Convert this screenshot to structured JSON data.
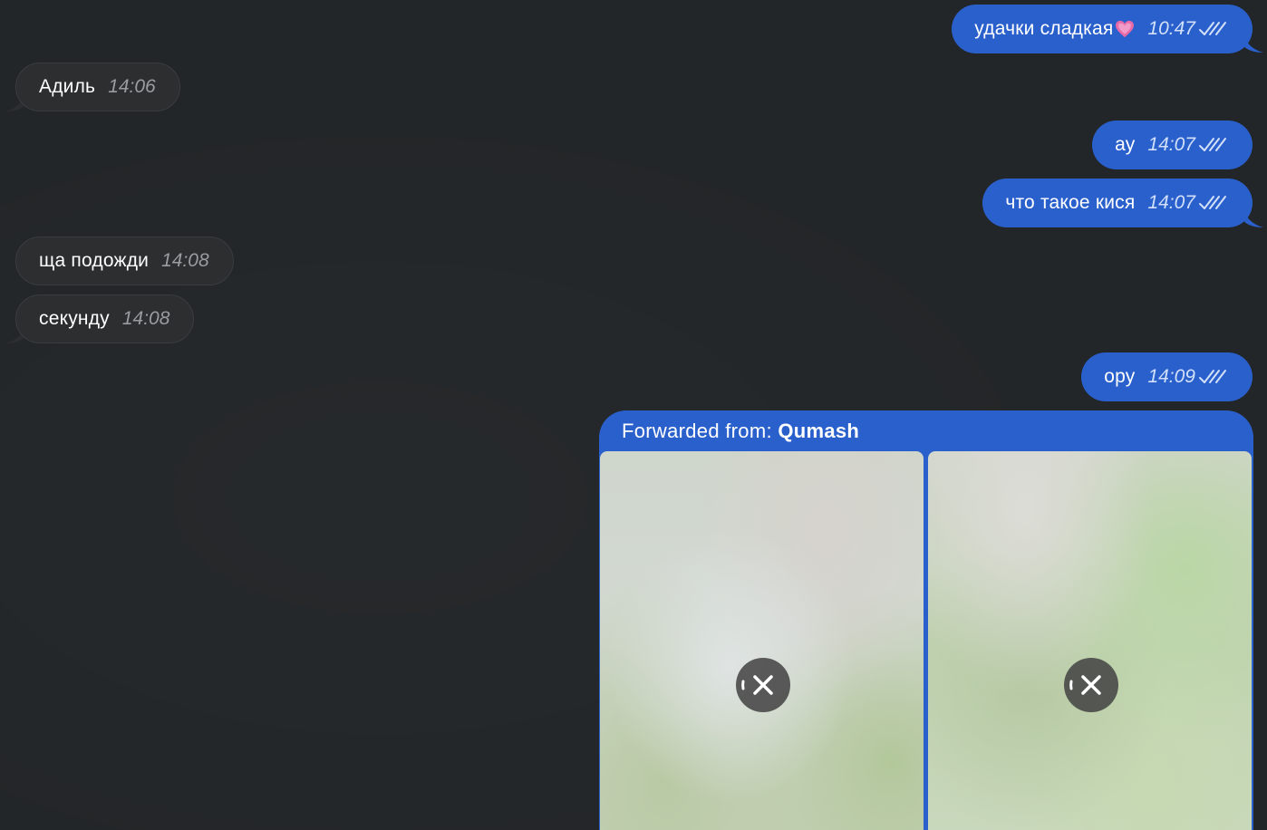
{
  "messages": [
    {
      "id": "m1",
      "direction": "out",
      "text": "удачки сладкая",
      "emoji": "heart-emoji",
      "time": "10:47",
      "read": true
    },
    {
      "id": "m2",
      "direction": "in",
      "text": "Адиль",
      "time": "14:06"
    },
    {
      "id": "m3",
      "direction": "out",
      "text": "ау",
      "time": "14:07",
      "read": true
    },
    {
      "id": "m4",
      "direction": "out",
      "text": "что такое кися",
      "time": "14:07",
      "read": true
    },
    {
      "id": "m5",
      "direction": "in",
      "text": "ща подожди",
      "time": "14:08"
    },
    {
      "id": "m6",
      "direction": "in",
      "text": "секунду",
      "time": "14:08"
    },
    {
      "id": "m7",
      "direction": "out",
      "text": "ору",
      "time": "14:09",
      "read": true
    }
  ],
  "forwarded": {
    "prefix": "Forwarded from:",
    "source": "Qumash",
    "media_count": 2,
    "media_state": "loading"
  },
  "colors": {
    "background": "#232628",
    "incoming_bubble": "#2c2e30",
    "outgoing_bubble": "#2a60cc"
  },
  "icons": {
    "read_receipt": "double-check-icon",
    "cancel_download": "close-icon",
    "emoji": "heart-emoji"
  }
}
